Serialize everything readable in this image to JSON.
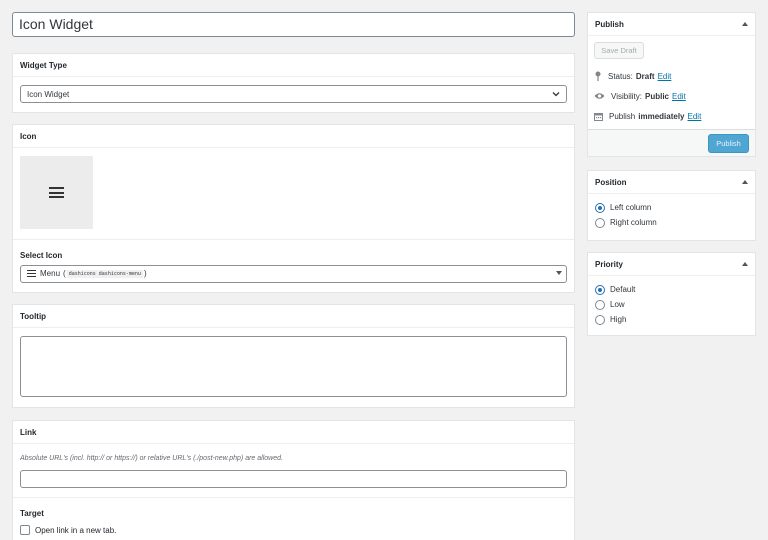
{
  "title_field": {
    "value": "Icon Widget"
  },
  "widget_type": {
    "heading": "Widget Type",
    "selected": "Icon Widget"
  },
  "icon": {
    "heading": "Icon",
    "select_label": "Select Icon",
    "selected_name": "Menu",
    "selected_class": "dashicons dashicons-menu",
    "paren_open": "(",
    "paren_close": ")",
    "icon_name": "menu-icon"
  },
  "tooltip": {
    "heading": "Tooltip",
    "value": ""
  },
  "link": {
    "heading": "Link",
    "help": "Absolute URL's (incl. http:// or https://) or relative URL's (./post-new.php) are allowed.",
    "value": "",
    "target_label": "Target",
    "new_tab_label": "Open link in a new tab."
  },
  "publish": {
    "heading": "Publish",
    "save_draft": "Save Draft",
    "status_label": "Status:",
    "status_value": "Draft",
    "visibility_label": "Visibility:",
    "visibility_value": "Public",
    "publish_label": "Publish",
    "publish_value": "immediately",
    "edit": "Edit",
    "publish_button": "Publish"
  },
  "position": {
    "heading": "Position",
    "options": [
      "Left column",
      "Right column"
    ],
    "selected": "Left column"
  },
  "priority": {
    "heading": "Priority",
    "options": [
      "Default",
      "Low",
      "High"
    ],
    "selected": "Default"
  },
  "colors": {
    "accent": "#2271b1",
    "link": "#0073aa",
    "publish_button": "#4fa6d3"
  }
}
